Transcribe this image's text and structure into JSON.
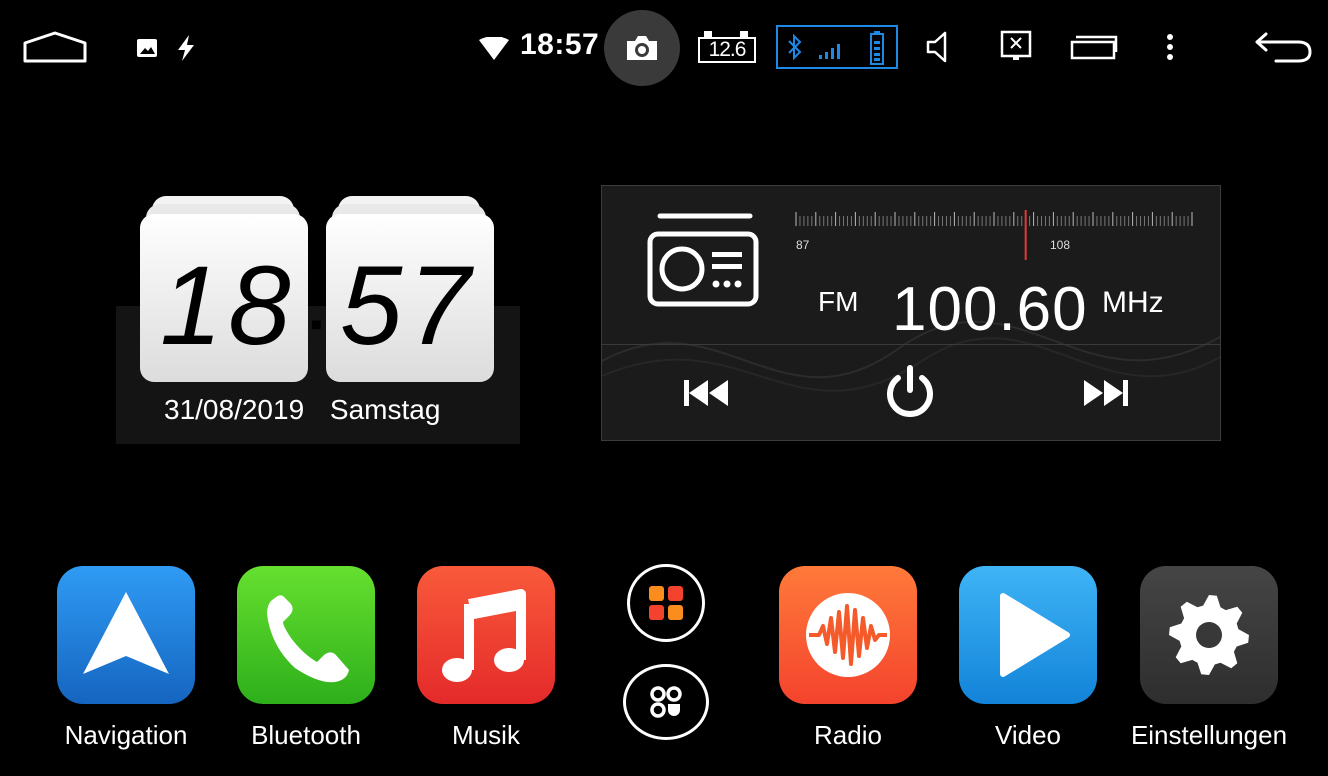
{
  "status_bar": {
    "time": "18:57",
    "battery_voltage": "12.6",
    "icons": [
      "home-icon",
      "image-notification-icon",
      "usb-charge-icon",
      "wifi-icon",
      "camera-icon",
      "battery-voltage-icon",
      "bluetooth-icon",
      "signal-icon",
      "phone-battery-icon",
      "volume-icon",
      "screen-off-icon",
      "recent-apps-icon",
      "more-icon",
      "back-icon"
    ]
  },
  "clock_widget": {
    "hours": "18",
    "minutes": "57",
    "separator": ":",
    "date": "31/08/2019",
    "weekday": "Samstag"
  },
  "radio_widget": {
    "band": "FM",
    "frequency": "100.60",
    "unit": "MHz",
    "scale_min_label": "87",
    "scale_max_label": "108",
    "needle_position": 0.58,
    "needle_color": "#e53935"
  },
  "dock": {
    "apps": [
      {
        "label": "Navigation",
        "icon": "navigation-arrow-icon",
        "color": "#1e88e5"
      },
      {
        "label": "Bluetooth",
        "icon": "phone-icon",
        "color": "#43c927"
      },
      {
        "label": "Musik",
        "icon": "music-note-icon",
        "color": "#f4432d"
      },
      {
        "label": "Radio",
        "icon": "radio-wave-icon",
        "color": "#fb6a2c"
      },
      {
        "label": "Video",
        "icon": "play-icon",
        "color": "#1e9ff0"
      },
      {
        "label": "Einstellungen",
        "icon": "gear-icon",
        "color": "#3a3a3a"
      }
    ],
    "center_buttons": [
      "app-grid-icon",
      "widgets-icon"
    ]
  },
  "colors": {
    "background": "#000000",
    "accent_blue": "#1e88e5",
    "radio_panel": "#1b1b1b"
  }
}
